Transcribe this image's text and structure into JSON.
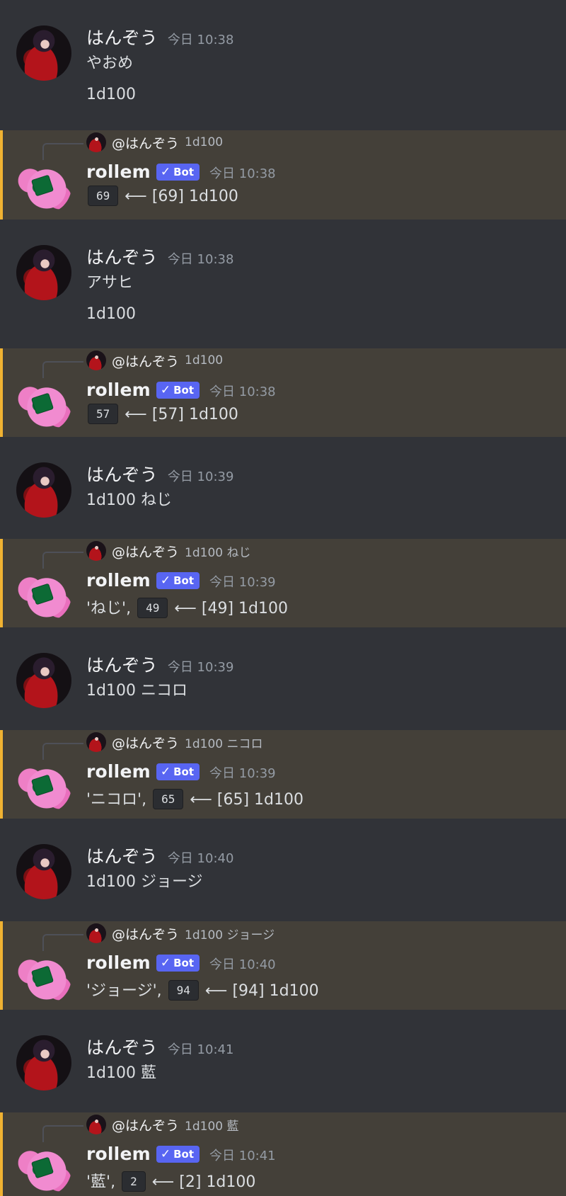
{
  "messages": [
    {
      "type": "user",
      "author": "はんぞう",
      "time": "今日 10:38",
      "lines": [
        "やおめ",
        "1d100"
      ]
    },
    {
      "type": "bot",
      "reply_to": "@はんぞう",
      "reply_text": "1d100",
      "author": "rollem",
      "badge": "Bot",
      "time": "今日 10:38",
      "label": "",
      "result": "69",
      "arrow": "⟵",
      "detail": "[69] 1d100"
    },
    {
      "type": "user",
      "author": "はんぞう",
      "time": "今日 10:38",
      "lines": [
        "アサヒ",
        "1d100"
      ]
    },
    {
      "type": "bot",
      "reply_to": "@はんぞう",
      "reply_text": "1d100",
      "author": "rollem",
      "badge": "Bot",
      "time": "今日 10:38",
      "label": "",
      "result": "57",
      "arrow": "⟵",
      "detail": "[57] 1d100"
    },
    {
      "type": "user",
      "author": "はんぞう",
      "time": "今日 10:39",
      "lines": [
        "1d100 ねじ"
      ]
    },
    {
      "type": "bot",
      "reply_to": "@はんぞう",
      "reply_text": "1d100 ねじ",
      "author": "rollem",
      "badge": "Bot",
      "time": "今日 10:39",
      "label": "'ねじ',",
      "result": "49",
      "arrow": "⟵",
      "detail": "[49] 1d100"
    },
    {
      "type": "user",
      "author": "はんぞう",
      "time": "今日 10:39",
      "lines": [
        "1d100 ニコロ"
      ]
    },
    {
      "type": "bot",
      "reply_to": "@はんぞう",
      "reply_text": "1d100 ニコロ",
      "author": "rollem",
      "badge": "Bot",
      "time": "今日 10:39",
      "label": "'ニコロ',",
      "result": "65",
      "arrow": "⟵",
      "detail": "[65] 1d100"
    },
    {
      "type": "user",
      "author": "はんぞう",
      "time": "今日 10:40",
      "lines": [
        "1d100 ジョージ"
      ]
    },
    {
      "type": "bot",
      "reply_to": "@はんぞう",
      "reply_text": "1d100 ジョージ",
      "author": "rollem",
      "badge": "Bot",
      "time": "今日 10:40",
      "label": "'ジョージ',",
      "result": "94",
      "arrow": "⟵",
      "detail": "[94] 1d100"
    },
    {
      "type": "user",
      "author": "はんぞう",
      "time": "今日 10:41",
      "lines": [
        "1d100 藍"
      ]
    },
    {
      "type": "bot",
      "reply_to": "@はんぞう",
      "reply_text": "1d100 藍",
      "author": "rollem",
      "badge": "Bot",
      "time": "今日 10:41",
      "label": "'藍',",
      "result": "2",
      "arrow": "⟵",
      "detail": "[2] 1d100"
    }
  ],
  "icons": {
    "check": "checkmark-icon"
  },
  "colors": {
    "accent_bar": "#f0b232",
    "bot_badge": "#5865f2",
    "bot_bg": "#444039",
    "user_bg": "#313338"
  }
}
